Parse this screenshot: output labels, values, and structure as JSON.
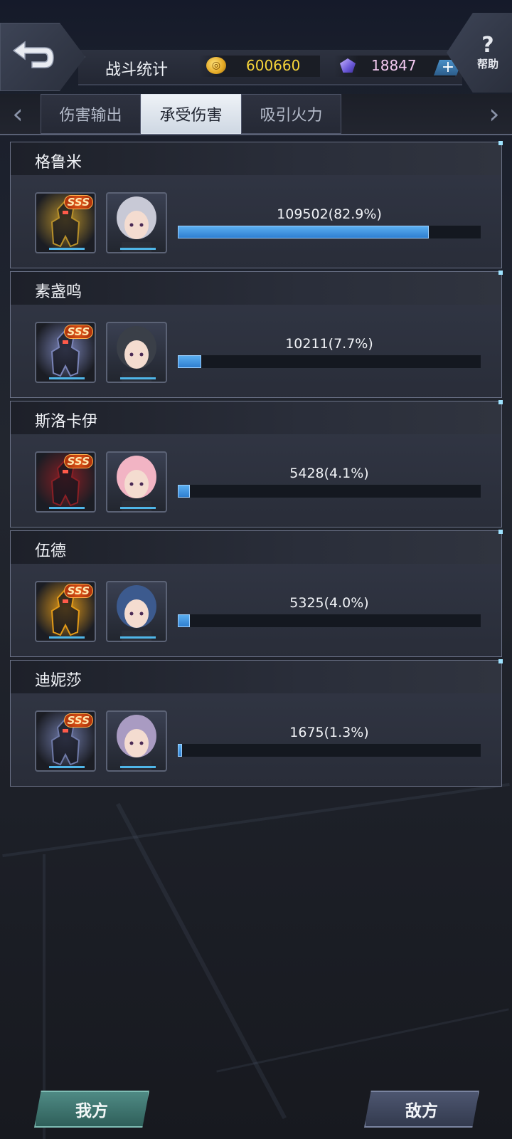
{
  "header": {
    "title": "战斗统计",
    "gold": "600660",
    "gems": "18847",
    "add_label": "+",
    "help_symbol": "?",
    "help_label": "帮助"
  },
  "tabs": [
    {
      "label": "伤害输出",
      "active": false
    },
    {
      "label": "承受伤害",
      "active": true
    },
    {
      "label": "吸引火力",
      "active": false
    }
  ],
  "nav": {
    "prev": "‹",
    "next": "›"
  },
  "stats": [
    {
      "name": "格鲁米",
      "value": "109502(82.9%)",
      "fraction": 0.829,
      "rank": "SSS",
      "mech_color": "#b8902a",
      "pilot_color": "#c8c9d6"
    },
    {
      "name": "素盏鸣",
      "value": "10211(7.7%)",
      "fraction": 0.077,
      "rank": "SSS",
      "mech_color": "#7a84b8",
      "pilot_color": "#3a3f48"
    },
    {
      "name": "斯洛卡伊",
      "value": "5428(4.1%)",
      "fraction": 0.041,
      "rank": "SSS",
      "mech_color": "#8a1f25",
      "pilot_color": "#f2b4c4"
    },
    {
      "name": "伍德",
      "value": "5325(4.0%)",
      "fraction": 0.04,
      "rank": "SSS",
      "mech_color": "#e39a18",
      "pilot_color": "#3c5a8e"
    },
    {
      "name": "迪妮莎",
      "value": "1675(1.3%)",
      "fraction": 0.013,
      "rank": "SSS",
      "mech_color": "#6f7aa8",
      "pilot_color": "#a99bc2"
    }
  ],
  "footer": {
    "mine_label": "我方",
    "enemy_label": "敌方"
  },
  "colors": {
    "accent_blue": "#2f7fd0",
    "gold_text": "#f7d53a",
    "gem_text": "#f3c9f0"
  }
}
